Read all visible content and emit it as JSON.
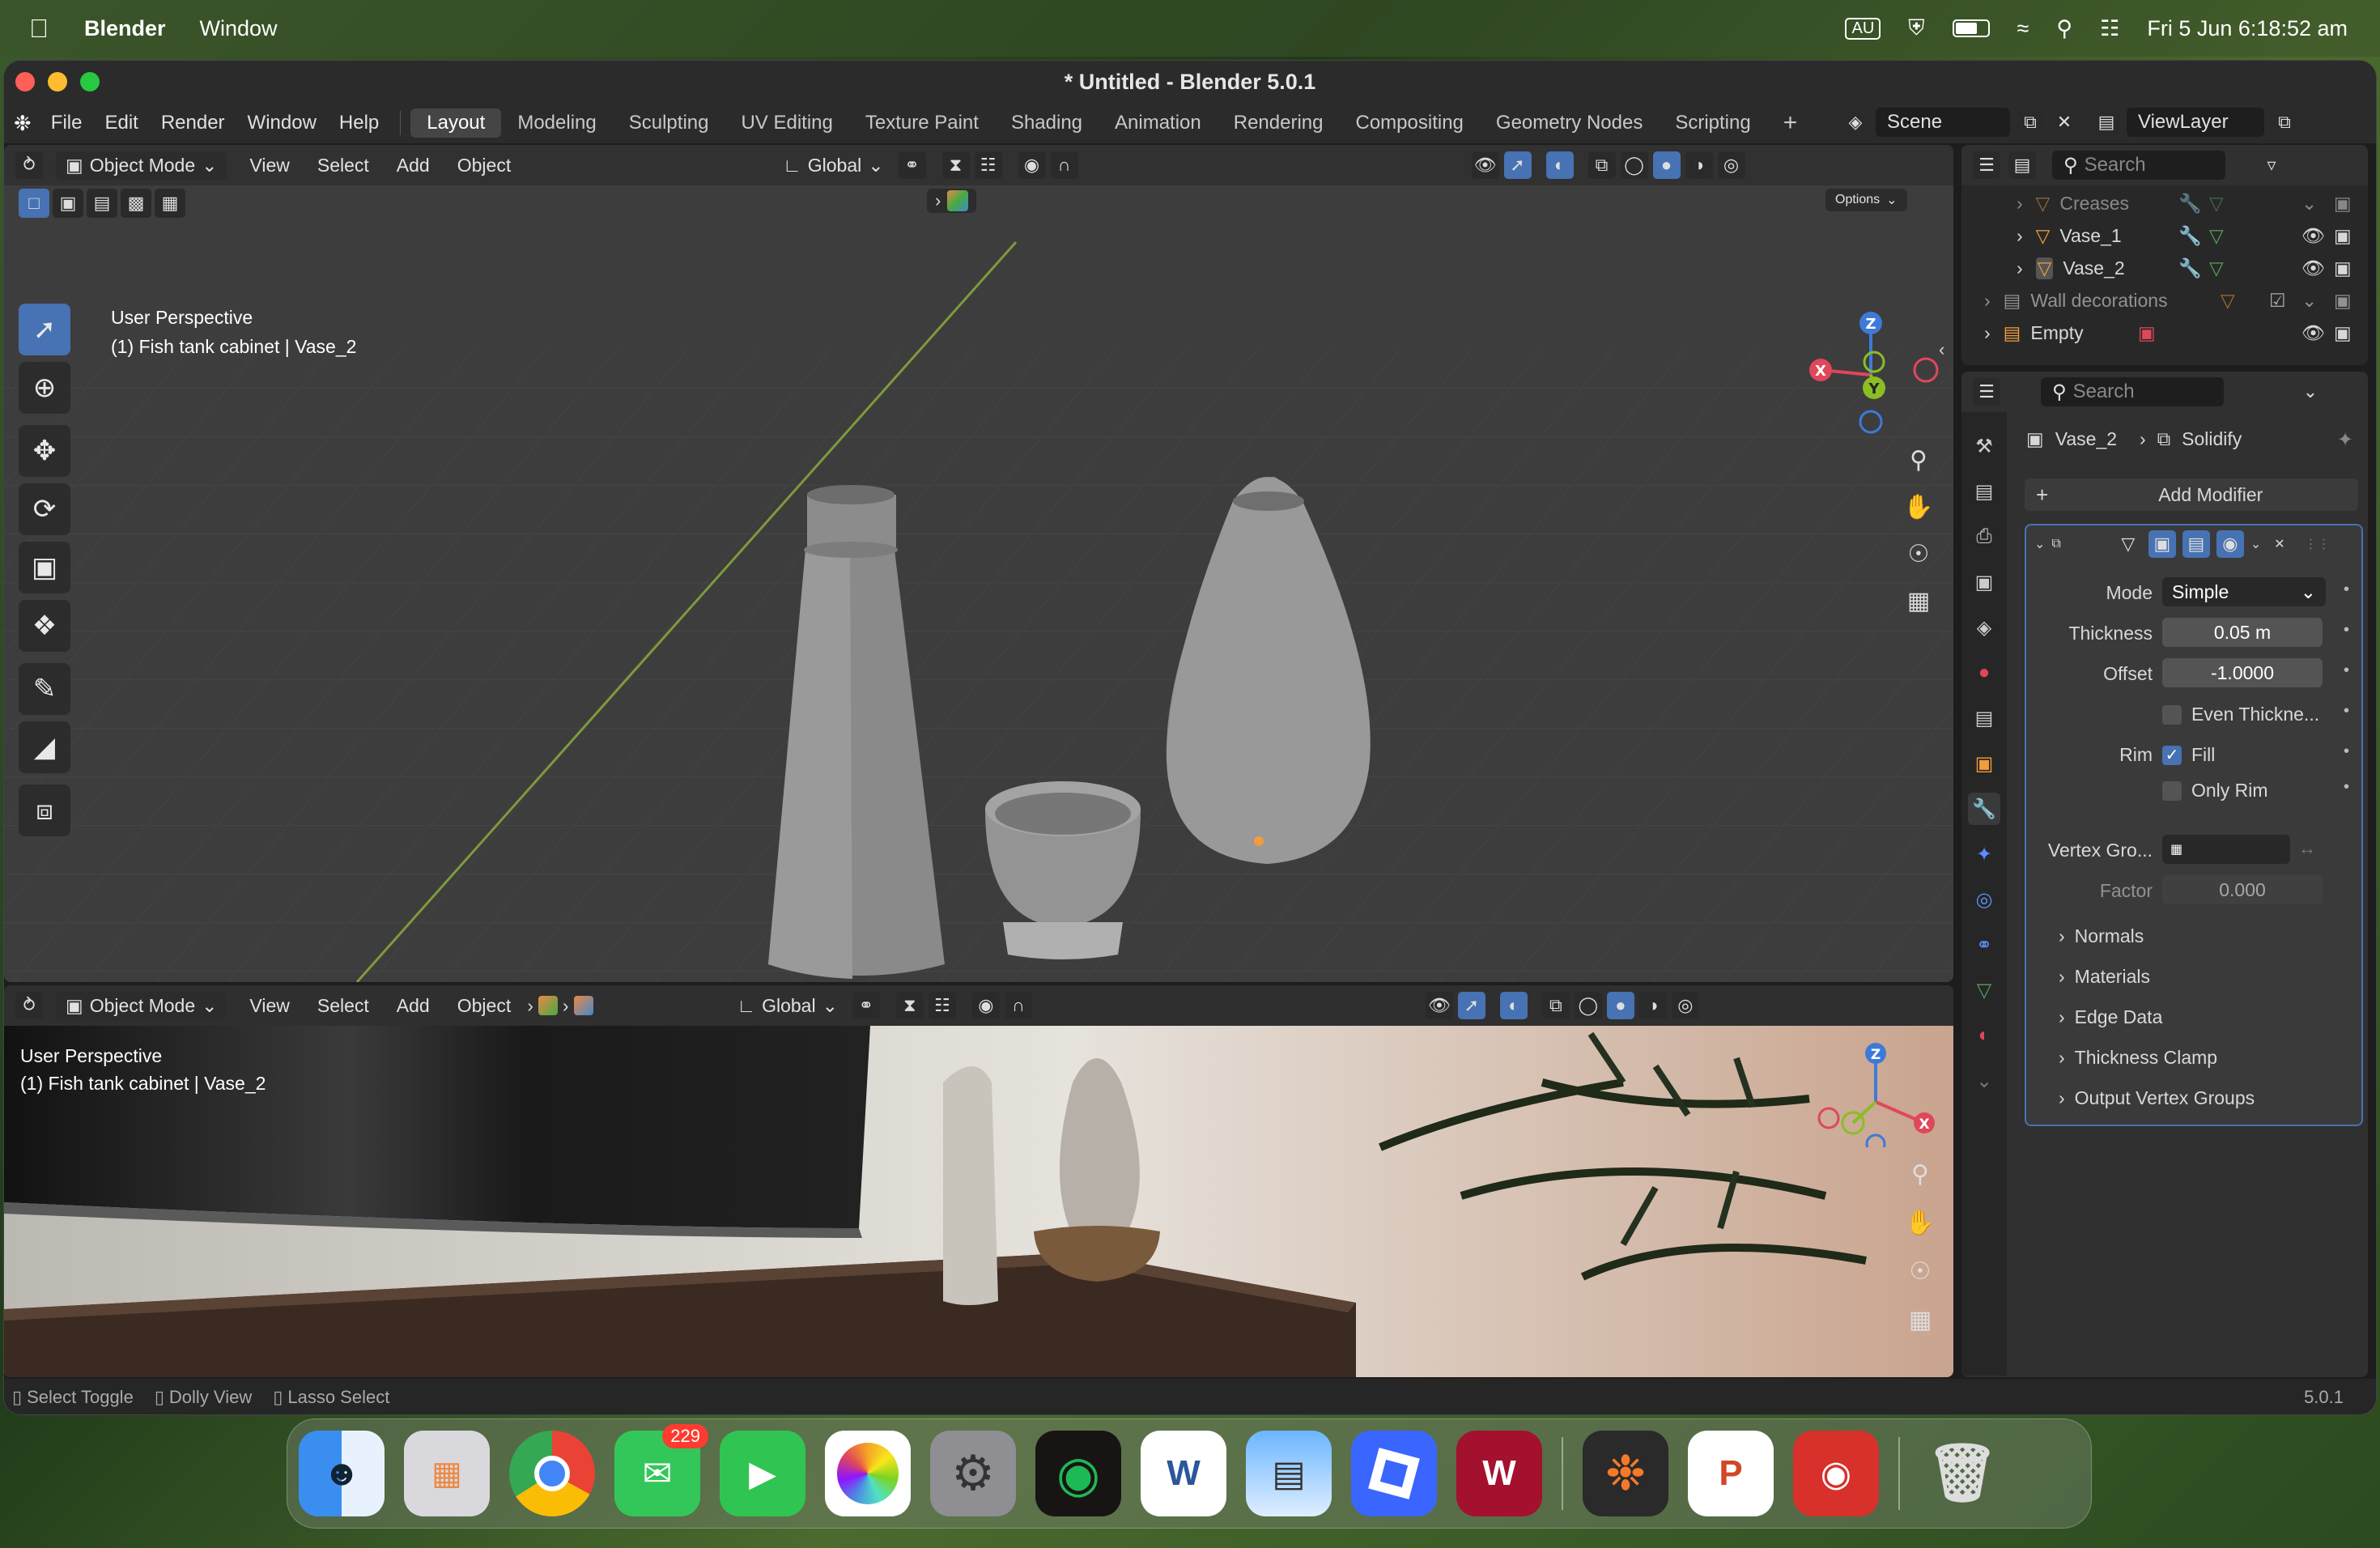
{
  "menubar": {
    "app_name": "Blender",
    "items": [
      "Window"
    ],
    "input_source": "AU",
    "clock": "Fri 5 Jun  6:18:52 am"
  },
  "window": {
    "title": "* Untitled - Blender 5.0.1",
    "menu": [
      "File",
      "Edit",
      "Render",
      "Window",
      "Help"
    ],
    "workspaces": [
      "Layout",
      "Modeling",
      "Sculpting",
      "UV Editing",
      "Texture Paint",
      "Shading",
      "Animation",
      "Rendering",
      "Compositing",
      "Geometry Nodes",
      "Scripting"
    ],
    "active_workspace": "Layout",
    "scene": "Scene",
    "view_layer": "ViewLayer"
  },
  "viewport_top": {
    "mode": "Object Mode",
    "menus": [
      "View",
      "Select",
      "Add",
      "Object"
    ],
    "transform_orientation": "Global",
    "options": "Options",
    "view_name": "User Perspective",
    "object_info": "(1) Fish tank cabinet | Vase_2"
  },
  "viewport_bottom": {
    "mode": "Object Mode",
    "menus": [
      "View",
      "Select",
      "Add",
      "Object"
    ],
    "transform_orientation": "Global",
    "view_name": "User Perspective",
    "object_info": "(1) Fish tank cabinet | Vase_2"
  },
  "outliner": {
    "search_placeholder": "Search",
    "rows": [
      {
        "name": "Creases"
      },
      {
        "name": "Vase_1"
      },
      {
        "name": "Vase_2"
      },
      {
        "name": "Wall decorations"
      },
      {
        "name": "Empty"
      }
    ]
  },
  "properties": {
    "search_placeholder": "Search",
    "breadcrumb_object": "Vase_2",
    "breadcrumb_modifier": "Solidify",
    "add_modifier": "Add Modifier",
    "fields": {
      "mode_label": "Mode",
      "mode_value": "Simple",
      "thickness_label": "Thickness",
      "thickness_value": "0.05 m",
      "offset_label": "Offset",
      "offset_value": "-1.0000",
      "even_label": "Even Thickne...",
      "rim_label": "Rim",
      "fill_label": "Fill",
      "only_rim_label": "Only Rim",
      "vertex_group_label": "Vertex Gro...",
      "factor_label": "Factor",
      "factor_value": "0.000"
    },
    "subpanels": [
      "Normals",
      "Materials",
      "Edge Data",
      "Thickness Clamp",
      "Output Vertex Groups"
    ]
  },
  "statusbar": {
    "hints": [
      "Select Toggle",
      "Dolly View",
      "Lasso Select"
    ],
    "version": "5.0.1"
  },
  "dock": {
    "messages_badge": "229",
    "apps": [
      "Finder",
      "Launchpad",
      "Chrome",
      "Messages",
      "FaceTime",
      "Photos",
      "System Settings",
      "Spotify",
      "Word",
      "Preview",
      "Roblox",
      "WPS",
      "Blender",
      "PowerPoint",
      "Photo Booth",
      "Trash"
    ]
  },
  "colors": {
    "accent": "#4772b3",
    "x_axis": "#e0475b",
    "y_axis": "#8bbd24",
    "z_axis": "#3d7ad8",
    "modifier_icon": "#5a8cff",
    "object_orange": "#f29d3a"
  }
}
